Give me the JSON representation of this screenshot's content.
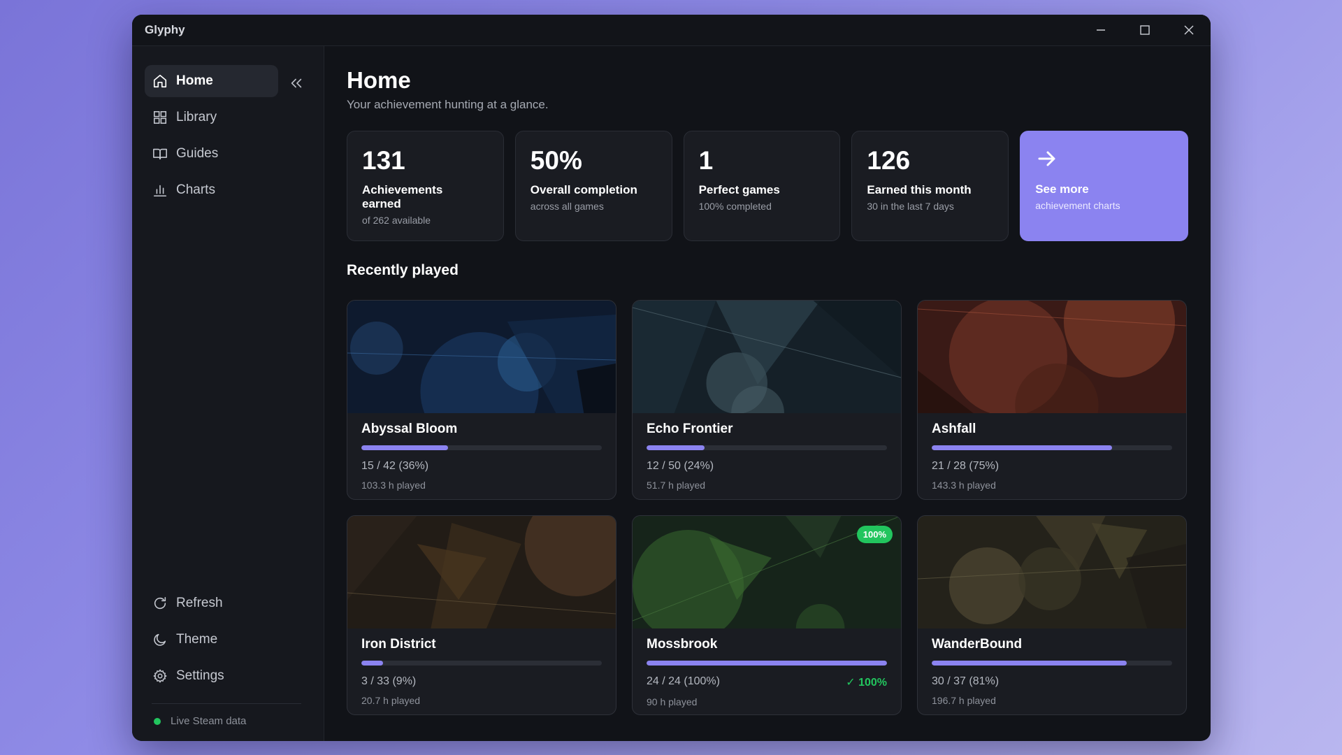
{
  "window": {
    "title": "Glyphy"
  },
  "sidebar": {
    "items": [
      {
        "label": "Home",
        "icon": "home-icon"
      },
      {
        "label": "Library",
        "icon": "grid-icon"
      },
      {
        "label": "Guides",
        "icon": "book-icon"
      },
      {
        "label": "Charts",
        "icon": "bar-chart-icon"
      }
    ],
    "bottom_items": [
      {
        "label": "Refresh",
        "icon": "refresh-icon"
      },
      {
        "label": "Theme",
        "icon": "moon-icon"
      },
      {
        "label": "Settings",
        "icon": "gear-icon"
      }
    ],
    "status": "Live Steam data"
  },
  "main": {
    "title": "Home",
    "subtitle": "Your achievement hunting at a glance.",
    "stats": [
      {
        "value": "131",
        "label": "Achievements earned",
        "sub": "of 262 available"
      },
      {
        "value": "50%",
        "label": "Overall completion",
        "sub": "across all games"
      },
      {
        "value": "1",
        "label": "Perfect games",
        "sub": "100% completed"
      },
      {
        "value": "126",
        "label": "Earned this month",
        "sub": "30 in the last 7 days"
      }
    ],
    "cta": {
      "label": "See more",
      "sub": "achievement charts",
      "accent": "#8b83f0"
    },
    "section_title": "Recently played",
    "games": [
      {
        "name": "Abyssal Bloom",
        "count": "15 / 42  (36%)",
        "progress": 0.36,
        "hours": "103.3 h played"
      },
      {
        "name": "Echo Frontier",
        "count": "12 / 50  (24%)",
        "progress": 0.24,
        "hours": "51.7 h played"
      },
      {
        "name": "Ashfall",
        "count": "21 / 28  (75%)",
        "progress": 0.75,
        "hours": "143.3 h played"
      },
      {
        "name": "Iron District",
        "count": "3 / 33  (9%)",
        "progress": 0.09,
        "hours": "20.7 h played"
      },
      {
        "name": "Mossbrook",
        "count": "24 / 24  (100%)",
        "progress": 1.0,
        "hours": "90 h played",
        "badge": "100%",
        "done": "✓ 100%"
      },
      {
        "name": "WanderBound",
        "count": "30 / 37  (81%)",
        "progress": 0.81,
        "hours": "196.7 h played"
      }
    ]
  },
  "colors": {
    "accent": "#8b83f0",
    "success": "#22c55e",
    "background": "#111318"
  }
}
